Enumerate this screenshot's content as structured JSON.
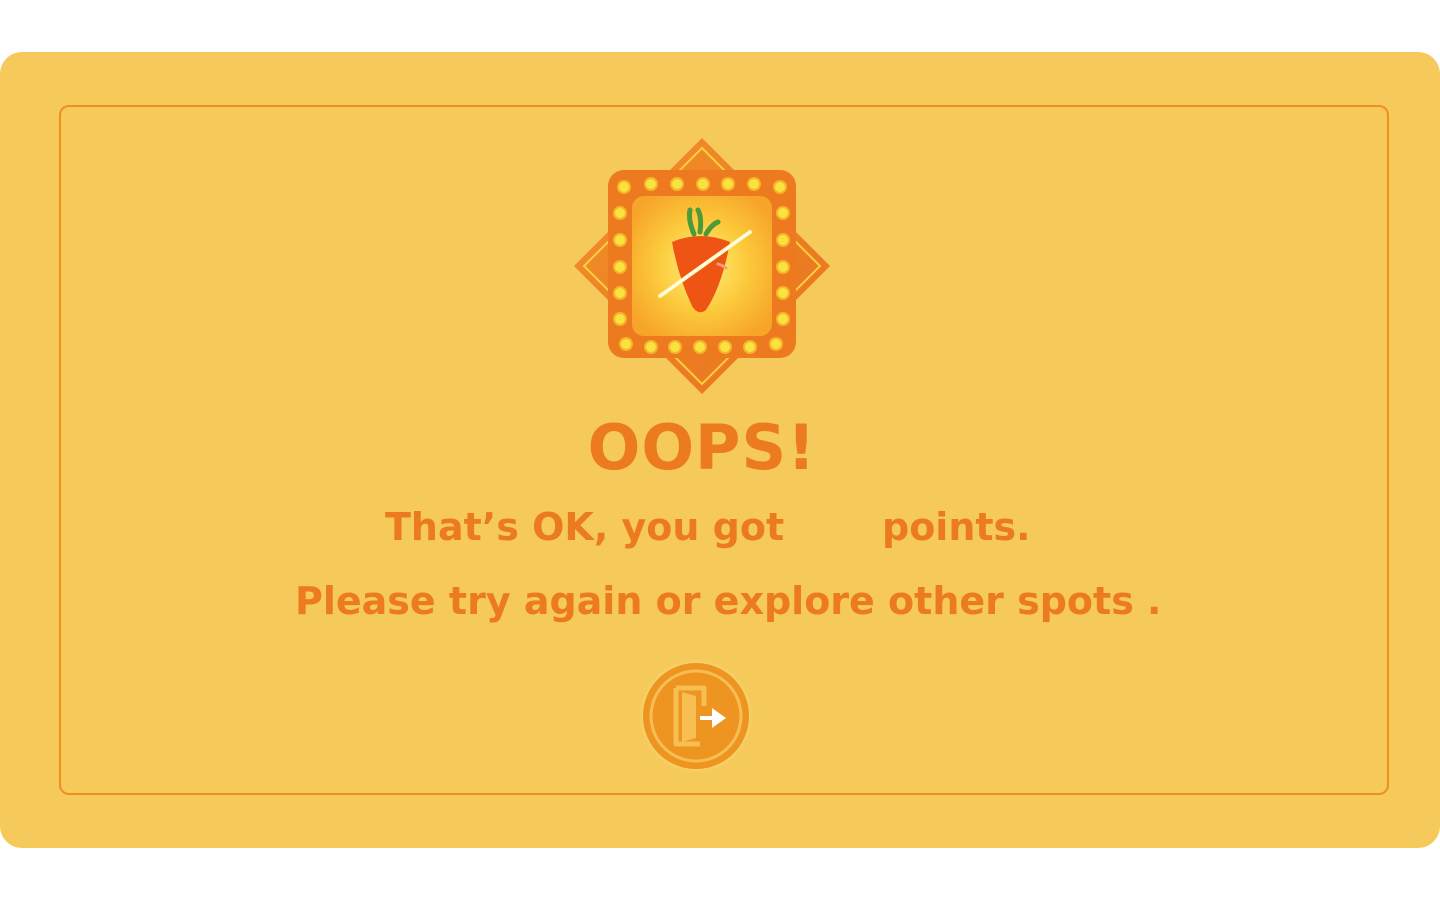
{
  "result": {
    "title": "OOPS!",
    "message_before_points": "That’s OK, you got",
    "points_value": "",
    "message_after_points": "points.",
    "retry_message": "Please try again or explore other spots ."
  },
  "icons": {
    "badge": "carrot-badge-icon",
    "exit": "exit-door-icon"
  },
  "colors": {
    "panel_background": "#F5C95A",
    "accent": "#EC7A1E",
    "badge_orange": "#EE7A1F",
    "bulb_yellow": "#F9E33E",
    "carrot": "#EE5515"
  }
}
